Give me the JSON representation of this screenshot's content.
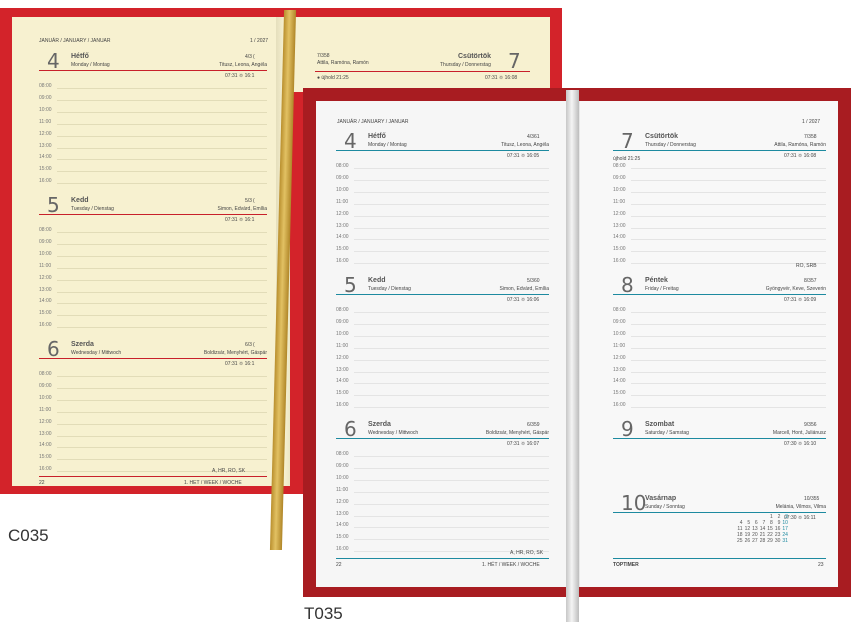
{
  "back": {
    "label": "C035",
    "header_month": "JANUÁR / JANUARY / JANUAR",
    "header_year": "1 / 2027",
    "days": [
      {
        "num": "4",
        "name": "Hétfő",
        "sub": "Monday / Montag",
        "doy": "4/3 (",
        "names": "Titusz, Leona, Angéla",
        "sun": "07:31 🌣 16:1"
      },
      {
        "num": "5",
        "name": "Kedd",
        "sub": "Tuesday / Dienstag",
        "doy": "5/3 (",
        "names": "Simon, Edvárd, Emília",
        "sun": "07:31 🌣 16:1"
      },
      {
        "num": "6",
        "name": "Szerda",
        "sub": "Wednesday / Mittwoch",
        "doy": "6/3 (",
        "names": "Boldizsár, Menyhért, Gáspár",
        "sun": "07:31 🌣 16:1"
      }
    ],
    "right_doy": "7/358",
    "right_names": "Attila, Ramóna, Ramón",
    "right_dayname": "Csütörtök",
    "right_sub": "Thursday / Donnerstag",
    "right_num": "7",
    "right_moon": "újhold 21:25",
    "right_sun": "07:31 🌣 16:08",
    "footer_page": "22",
    "footer_week": "1. HÉT / WEEK / WOCHE",
    "footer_holiday": "A, HR, RO, SK"
  },
  "hours": [
    "08:00",
    "09:00",
    "10:00",
    "11:00",
    "12:00",
    "13:00",
    "14:00",
    "15:00",
    "16:00"
  ],
  "front": {
    "label": "T035",
    "header_month": "JANUÁR / JANUARY / JANUAR",
    "header_year": "1 / 2027",
    "left_days": [
      {
        "num": "4",
        "name": "Hétfő",
        "sub": "Monday / Montag",
        "doy": "4/361",
        "names": "Titusz, Leona, Angéla",
        "sun": "07:31 🌣 16:05"
      },
      {
        "num": "5",
        "name": "Kedd",
        "sub": "Tuesday / Dienstag",
        "doy": "5/360",
        "names": "Simon, Edvárd, Emília",
        "sun": "07:31 🌣 16:06"
      },
      {
        "num": "6",
        "name": "Szerda",
        "sub": "Wednesday / Mittwoch",
        "doy": "6/359",
        "names": "Boldizsár, Menyhért, Gáspár",
        "sun": "07:31 🌣 16:07"
      }
    ],
    "right_days": [
      {
        "num": "7",
        "name": "Csütörtök",
        "sub": "Thursday / Donnerstag",
        "doy": "7/358",
        "names": "Attila, Ramóna, Ramón",
        "sun": "07:31 🌣 16:08",
        "moon": "újhold 21:25"
      },
      {
        "num": "8",
        "name": "Péntek",
        "sub": "Friday / Freitag",
        "doy": "8/357",
        "names": "Gyöngyvér, Keve, Szeverin",
        "sun": "07:31 🌣 16:09",
        "country": "RO, SRB"
      },
      {
        "num": "9",
        "name": "Szombat",
        "sub": "Saturday / Samstag",
        "doy": "9/356",
        "names": "Marcell, Hont, Juliánusz",
        "sun": "07:30 🌣 16:10"
      },
      {
        "num": "10",
        "name": "Vasárnap",
        "sub": "Sunday / Sonntag",
        "doy": "10/355",
        "names": "Melánia, Vilmos, Vilma",
        "sun": "07:30 🌣 16:11"
      }
    ],
    "mini_calendar": [
      [
        "",
        "",
        "",
        "",
        "1",
        "2",
        "3"
      ],
      [
        "4",
        "5",
        "6",
        "7",
        "8",
        "9",
        "10"
      ],
      [
        "11",
        "12",
        "13",
        "14",
        "15",
        "16",
        "17"
      ],
      [
        "18",
        "19",
        "20",
        "21",
        "22",
        "23",
        "24"
      ],
      [
        "25",
        "26",
        "27",
        "28",
        "29",
        "30",
        "31"
      ]
    ],
    "footer_left_page": "22",
    "footer_left_week": "1. HÉT / WEEK / WOCHE",
    "footer_left_holiday": "A, HR, RO, SK",
    "footer_right_brand": "TOPTIMER",
    "footer_right_page": "23"
  },
  "colors": {
    "back_cover": "#d3232a",
    "front_cover": "#a81c21",
    "accent_red": "#c8202a",
    "accent_teal": "#1d8aa0",
    "ribbon_gold": "#d4b04e"
  }
}
